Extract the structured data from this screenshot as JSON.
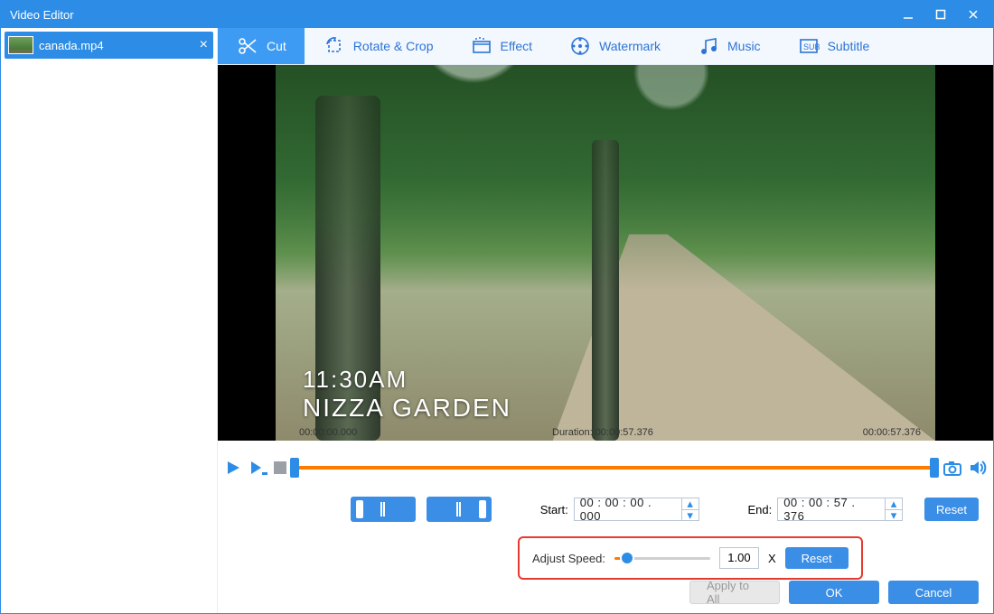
{
  "window": {
    "title": "Video Editor"
  },
  "sidebar": {
    "file": {
      "name": "canada.mp4"
    }
  },
  "toolbar": {
    "cut": {
      "label": "Cut"
    },
    "rotate": {
      "label": "Rotate & Crop"
    },
    "effect": {
      "label": "Effect"
    },
    "watermark": {
      "label": "Watermark"
    },
    "music": {
      "label": "Music"
    },
    "subtitle": {
      "label": "Subtitle"
    }
  },
  "preview": {
    "overlay_time": "11:30AM",
    "overlay_place": "NIZZA GARDEN"
  },
  "transport": {
    "start_time": "00:00:00.000",
    "duration_label": "Duration: 00:00:57.376",
    "end_time": "00:00:57.376"
  },
  "cut": {
    "start_label": "Start:",
    "start_value": "00 : 00 : 00 . 000",
    "end_label": "End:",
    "end_value": "00 : 00 : 57 . 376",
    "reset_label": "Reset"
  },
  "speed": {
    "label": "Adjust Speed:",
    "value": "1.00",
    "unit": "X",
    "reset_label": "Reset"
  },
  "footer": {
    "apply_all": "Apply to All",
    "ok": "OK",
    "cancel": "Cancel"
  }
}
